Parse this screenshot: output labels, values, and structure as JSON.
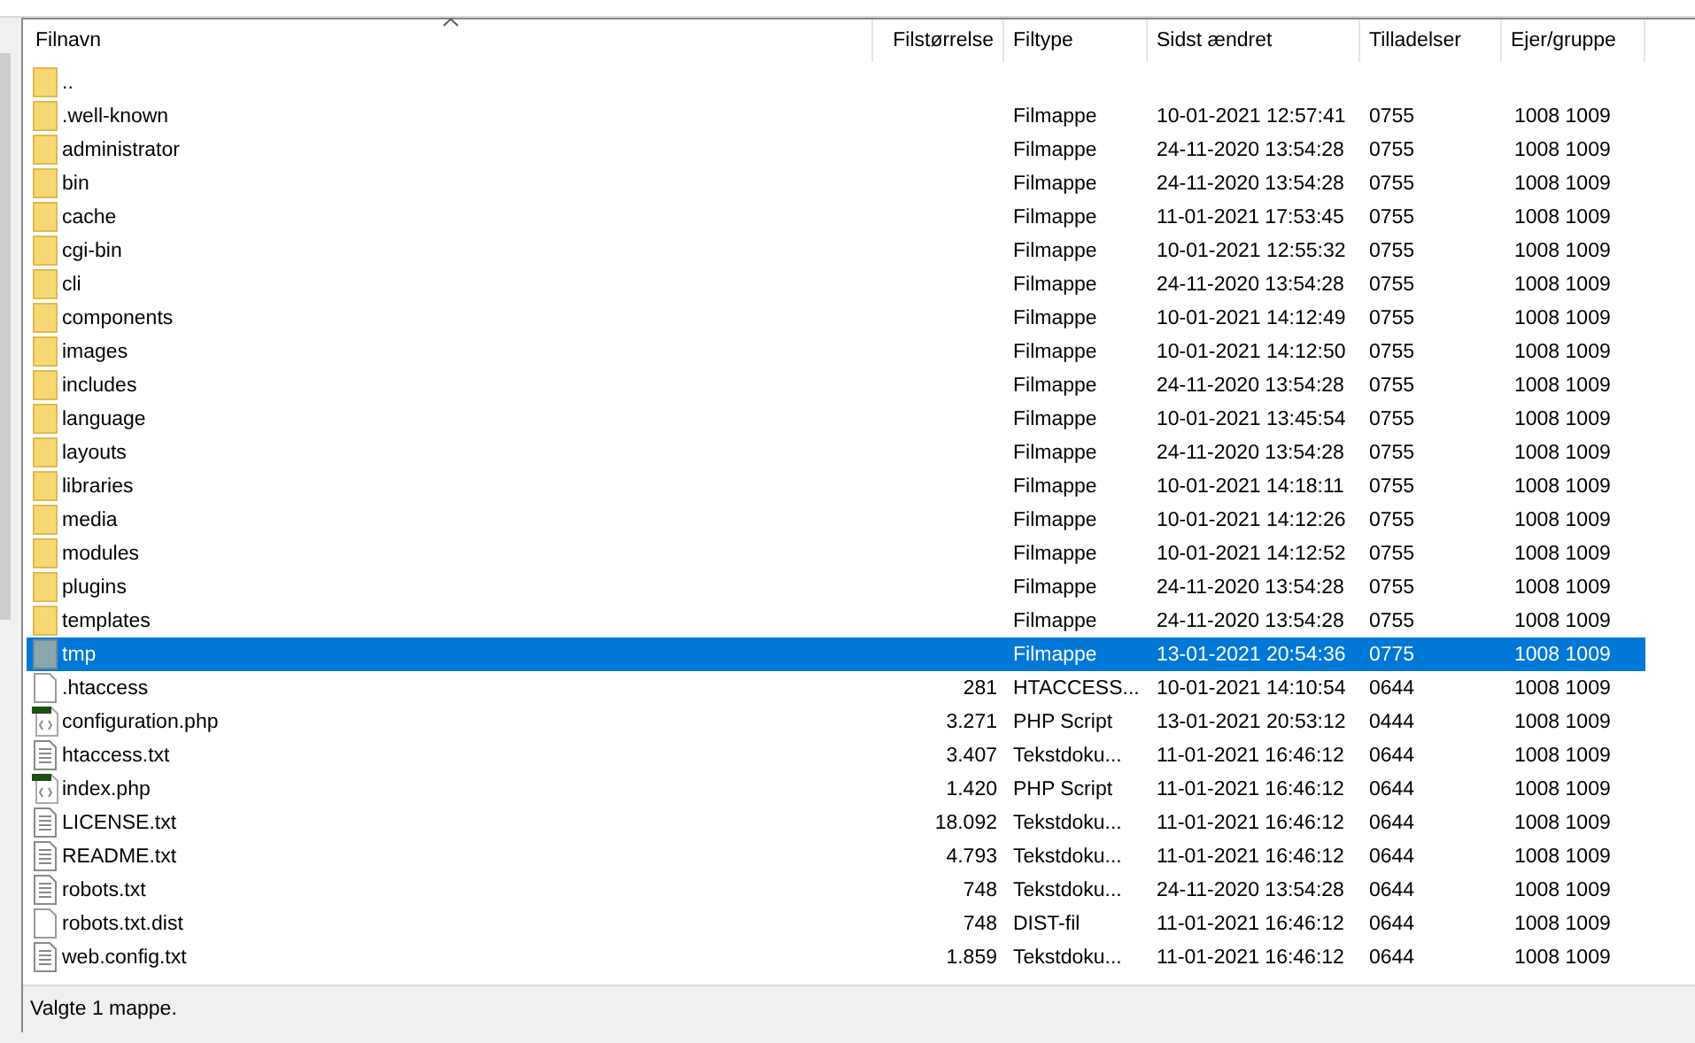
{
  "table": {
    "columns": [
      {
        "label": "Filnavn",
        "sorted": true
      },
      {
        "label": "Filstørrelse",
        "sorted": false
      },
      {
        "label": "Filtype",
        "sorted": false
      },
      {
        "label": "Sidst ændret",
        "sorted": false
      },
      {
        "label": "Tilladelser",
        "sorted": false
      },
      {
        "label": "Ejer/gruppe",
        "sorted": false
      }
    ],
    "rows": [
      {
        "kind": "folder",
        "name": "..",
        "selected": false
      },
      {
        "kind": "folder",
        "name": ".well-known",
        "type": "Filmappe",
        "modified": "10-01-2021 12:57:41",
        "perms": "0755",
        "owner": "1008 1009",
        "selected": false
      },
      {
        "kind": "folder",
        "name": "administrator",
        "type": "Filmappe",
        "modified": "24-11-2020 13:54:28",
        "perms": "0755",
        "owner": "1008 1009",
        "selected": false
      },
      {
        "kind": "folder",
        "name": "bin",
        "type": "Filmappe",
        "modified": "24-11-2020 13:54:28",
        "perms": "0755",
        "owner": "1008 1009",
        "selected": false
      },
      {
        "kind": "folder",
        "name": "cache",
        "type": "Filmappe",
        "modified": "11-01-2021 17:53:45",
        "perms": "0755",
        "owner": "1008 1009",
        "selected": false
      },
      {
        "kind": "folder",
        "name": "cgi-bin",
        "type": "Filmappe",
        "modified": "10-01-2021 12:55:32",
        "perms": "0755",
        "owner": "1008 1009",
        "selected": false
      },
      {
        "kind": "folder",
        "name": "cli",
        "type": "Filmappe",
        "modified": "24-11-2020 13:54:28",
        "perms": "0755",
        "owner": "1008 1009",
        "selected": false
      },
      {
        "kind": "folder",
        "name": "components",
        "type": "Filmappe",
        "modified": "10-01-2021 14:12:49",
        "perms": "0755",
        "owner": "1008 1009",
        "selected": false
      },
      {
        "kind": "folder",
        "name": "images",
        "type": "Filmappe",
        "modified": "10-01-2021 14:12:50",
        "perms": "0755",
        "owner": "1008 1009",
        "selected": false
      },
      {
        "kind": "folder",
        "name": "includes",
        "type": "Filmappe",
        "modified": "24-11-2020 13:54:28",
        "perms": "0755",
        "owner": "1008 1009",
        "selected": false
      },
      {
        "kind": "folder",
        "name": "language",
        "type": "Filmappe",
        "modified": "10-01-2021 13:45:54",
        "perms": "0755",
        "owner": "1008 1009",
        "selected": false
      },
      {
        "kind": "folder",
        "name": "layouts",
        "type": "Filmappe",
        "modified": "24-11-2020 13:54:28",
        "perms": "0755",
        "owner": "1008 1009",
        "selected": false
      },
      {
        "kind": "folder",
        "name": "libraries",
        "type": "Filmappe",
        "modified": "10-01-2021 14:18:11",
        "perms": "0755",
        "owner": "1008 1009",
        "selected": false
      },
      {
        "kind": "folder",
        "name": "media",
        "type": "Filmappe",
        "modified": "10-01-2021 14:12:26",
        "perms": "0755",
        "owner": "1008 1009",
        "selected": false
      },
      {
        "kind": "folder",
        "name": "modules",
        "type": "Filmappe",
        "modified": "10-01-2021 14:12:52",
        "perms": "0755",
        "owner": "1008 1009",
        "selected": false
      },
      {
        "kind": "folder",
        "name": "plugins",
        "type": "Filmappe",
        "modified": "24-11-2020 13:54:28",
        "perms": "0755",
        "owner": "1008 1009",
        "selected": false
      },
      {
        "kind": "folder",
        "name": "templates",
        "type": "Filmappe",
        "modified": "24-11-2020 13:54:28",
        "perms": "0755",
        "owner": "1008 1009",
        "selected": false
      },
      {
        "kind": "folder",
        "name": "tmp",
        "type": "Filmappe",
        "modified": "13-01-2021 20:54:36",
        "perms": "0775",
        "owner": "1008 1009",
        "selected": true
      },
      {
        "kind": "file",
        "name": ".htaccess",
        "size": "281",
        "type": "HTACCESS...",
        "modified": "10-01-2021 14:10:54",
        "perms": "0644",
        "owner": "1008 1009",
        "selected": false
      },
      {
        "kind": "php",
        "name": "configuration.php",
        "size": "3.271",
        "type": "PHP Script",
        "modified": "13-01-2021 20:53:12",
        "perms": "0444",
        "owner": "1008 1009",
        "selected": false
      },
      {
        "kind": "text",
        "name": "htaccess.txt",
        "size": "3.407",
        "type": "Tekstdoku...",
        "modified": "11-01-2021 16:46:12",
        "perms": "0644",
        "owner": "1008 1009",
        "selected": false
      },
      {
        "kind": "php",
        "name": "index.php",
        "size": "1.420",
        "type": "PHP Script",
        "modified": "11-01-2021 16:46:12",
        "perms": "0644",
        "owner": "1008 1009",
        "selected": false
      },
      {
        "kind": "text",
        "name": "LICENSE.txt",
        "size": "18.092",
        "type": "Tekstdoku...",
        "modified": "11-01-2021 16:46:12",
        "perms": "0644",
        "owner": "1008 1009",
        "selected": false
      },
      {
        "kind": "text",
        "name": "README.txt",
        "size": "4.793",
        "type": "Tekstdoku...",
        "modified": "11-01-2021 16:46:12",
        "perms": "0644",
        "owner": "1008 1009",
        "selected": false
      },
      {
        "kind": "text",
        "name": "robots.txt",
        "size": "748",
        "type": "Tekstdoku...",
        "modified": "24-11-2020 13:54:28",
        "perms": "0644",
        "owner": "1008 1009",
        "selected": false
      },
      {
        "kind": "file",
        "name": "robots.txt.dist",
        "size": "748",
        "type": "DIST-fil",
        "modified": "11-01-2021 16:46:12",
        "perms": "0644",
        "owner": "1008 1009",
        "selected": false
      },
      {
        "kind": "text",
        "name": "web.config.txt",
        "size": "1.859",
        "type": "Tekstdoku...",
        "modified": "11-01-2021 16:46:12",
        "perms": "0644",
        "owner": "1008 1009",
        "selected": false
      }
    ]
  },
  "status_bar": "Valgte 1 mappe."
}
